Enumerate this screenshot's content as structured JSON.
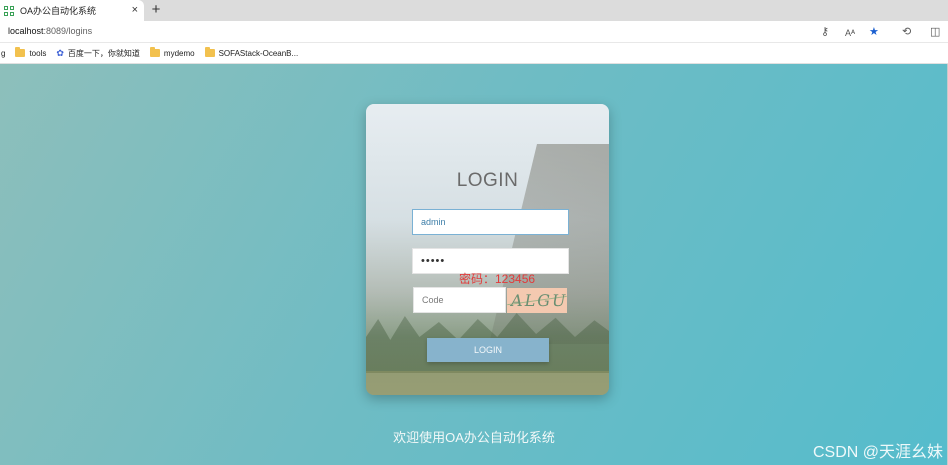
{
  "browser": {
    "tab_title": "OA办公自动化系统",
    "tab_close": "×",
    "new_tab": "+",
    "url_host": "localhost",
    "url_rest": ":8089/logins",
    "bookmarks": [
      {
        "label": "g",
        "icon": "none"
      },
      {
        "label": "tools",
        "icon": "folder-icon"
      },
      {
        "label": "百度一下，你就知道",
        "icon": "paw-icon"
      },
      {
        "label": "mydemo",
        "icon": "folder-icon"
      },
      {
        "label": "SOFAStack-OceanB...",
        "icon": "folder-icon"
      }
    ],
    "address_icons": [
      "key-icon",
      "read-aloud-icon",
      "favorite-star-icon",
      "extensions-icon",
      "split-screen-icon"
    ]
  },
  "login": {
    "title": "LOGIN",
    "username_value": "admin",
    "password_value": "•••••",
    "code_placeholder": "Code",
    "captcha_text": "ALGU",
    "password_hint": "密码：123456",
    "button_label": "LOGIN"
  },
  "footer_text": "欢迎使用OA办公自动化系统",
  "watermark": "CSDN @天涯幺妹",
  "colors": {
    "accent_button": "#87b3cc",
    "hint_red": "#e23a3a",
    "page_bg_start": "#8dbfbb",
    "page_bg_end": "#55bccc"
  }
}
